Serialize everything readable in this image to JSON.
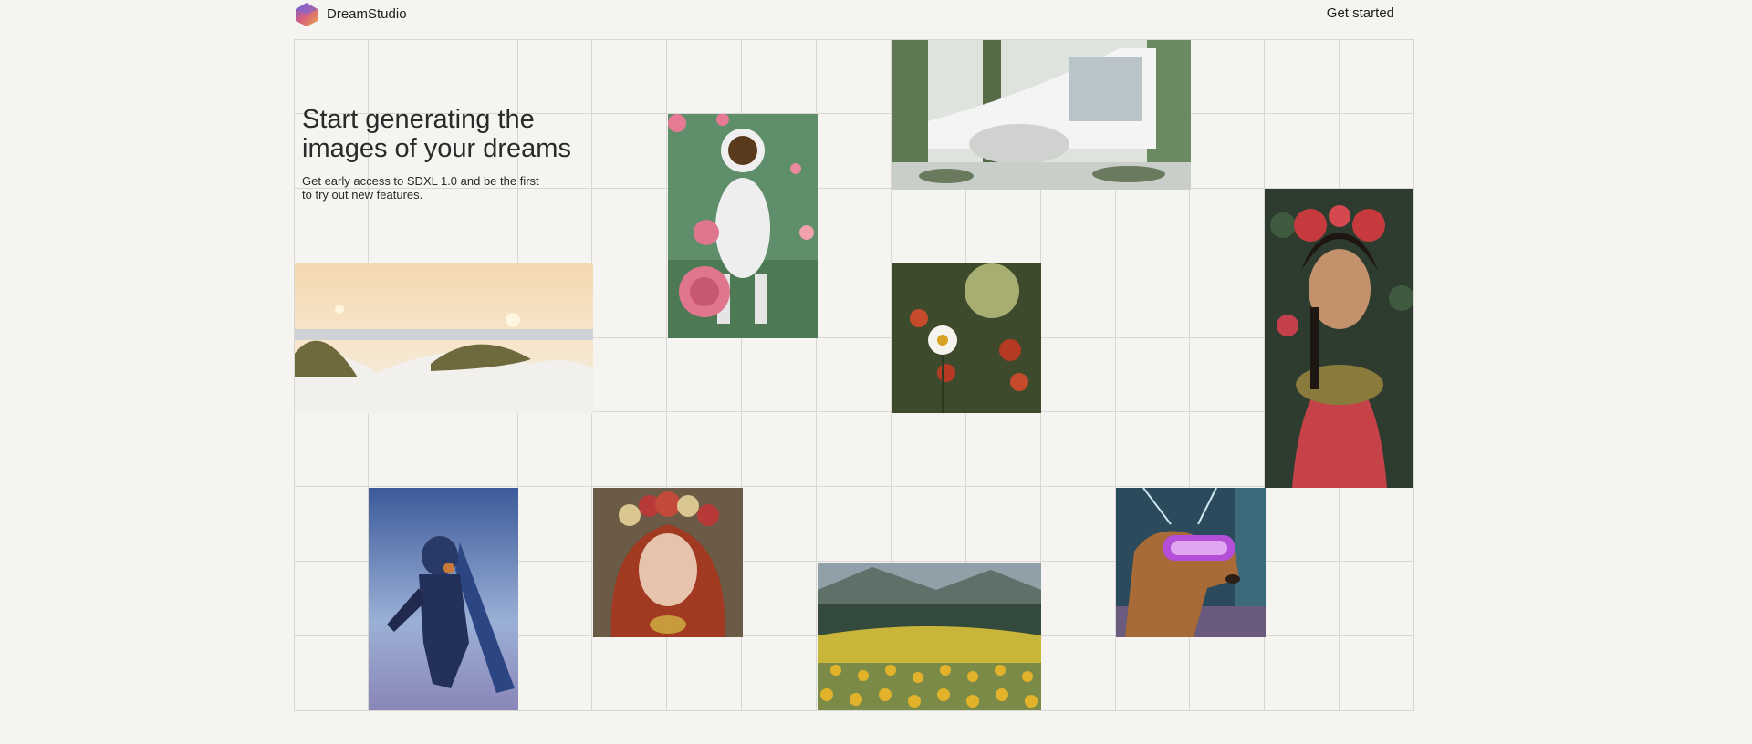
{
  "brand": {
    "name": "DreamStudio"
  },
  "nav": {
    "cta_label": "Get started"
  },
  "hero": {
    "title": "Start generating the images of your dreams",
    "subtitle": "Get early access to SDXL 1.0 and be the first to try out new features."
  },
  "gallery": {
    "images": [
      {
        "name": "astronaut-with-roses-image"
      },
      {
        "name": "modern-house-image"
      },
      {
        "name": "beach-dunes-sunset-image"
      },
      {
        "name": "daisy-flower-image"
      },
      {
        "name": "frida-portrait-image"
      },
      {
        "name": "armored-hero-image"
      },
      {
        "name": "flower-crown-woman-image"
      },
      {
        "name": "yellow-flower-field-image"
      },
      {
        "name": "vr-dog-image"
      }
    ]
  }
}
